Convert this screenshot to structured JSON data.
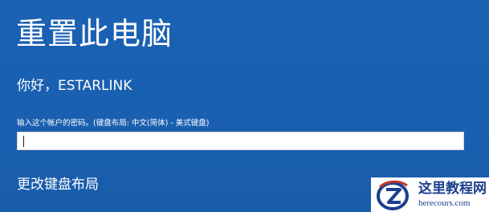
{
  "page": {
    "title": "重置此电脑",
    "greeting": "你好，ESTARLINK",
    "password_prompt": "输入这个帐户的密码。(键盘布局: 中文(简体) - 美式键盘)",
    "password_value": "",
    "change_keyboard_layout": "更改键盘布局"
  },
  "watermark": {
    "name": "这里教程网",
    "url": "herecours.com",
    "icon": "z-logo-icon"
  },
  "colors": {
    "background": "#1a5fb0",
    "text": "#ffffff",
    "field": "#ffffff",
    "watermark_text": "#1b3f8f",
    "watermark_accent": "#c0392b"
  }
}
